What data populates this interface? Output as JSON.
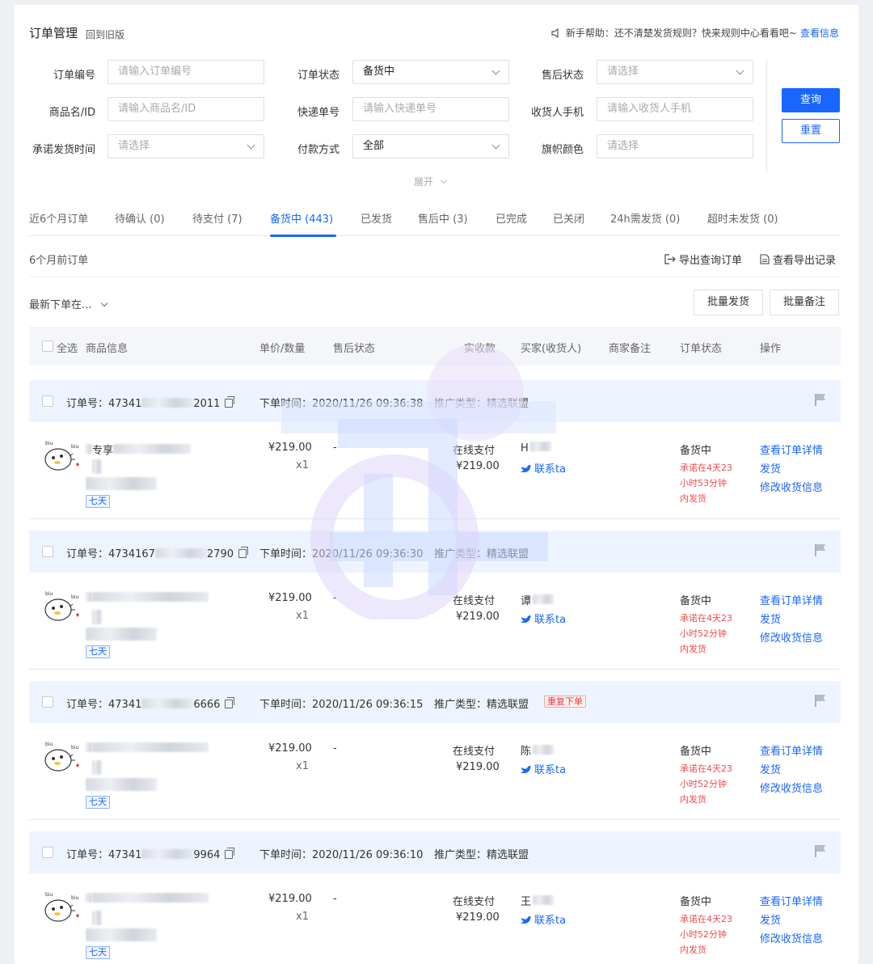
{
  "header": {
    "title": "订单管理",
    "back_old": "回到旧版",
    "help_text": "新手帮助：还不清楚发货规则？快来规则中心看看吧~",
    "help_link": "查看信息"
  },
  "filters": {
    "order_no": {
      "label": "订单编号",
      "placeholder": "请输入订单编号"
    },
    "order_status": {
      "label": "订单状态",
      "value": "备货中"
    },
    "after_sale": {
      "label": "售后状态",
      "placeholder": "请选择"
    },
    "product": {
      "label": "商品名/ID",
      "placeholder": "请输入商品名/ID"
    },
    "express": {
      "label": "快递单号",
      "placeholder": "请输入快递单号"
    },
    "phone": {
      "label": "收货人手机",
      "placeholder": "请输入收货人手机"
    },
    "promise_time": {
      "label": "承诺发货时间",
      "placeholder": "请选择"
    },
    "pay_method": {
      "label": "付款方式",
      "value": "全部"
    },
    "flag_color": {
      "label": "旗帜颜色",
      "placeholder": "请选择"
    },
    "query_label": "查询",
    "reset_label": "重置",
    "expand_label": "展开"
  },
  "tabs": [
    {
      "label": "近6个月订单"
    },
    {
      "label": "待确认 (0)"
    },
    {
      "label": "待支付 (7)"
    },
    {
      "label": "备货中 (443)"
    },
    {
      "label": "已发货"
    },
    {
      "label": "售后中 (3)"
    },
    {
      "label": "已完成"
    },
    {
      "label": "已关闭"
    },
    {
      "label": "24h需发货 (0)"
    },
    {
      "label": "超时未发货 (0)"
    }
  ],
  "toolbar": {
    "older_orders": "6个月前订单",
    "export_query": "导出查询订单",
    "view_export": "查看导出记录",
    "sort": "最新下单在...",
    "batch_ship": "批量发货",
    "batch_note": "批量备注"
  },
  "table_headers": {
    "select_all": "全选",
    "product_info": "商品信息",
    "price_qty": "单价/数量",
    "after_sale": "售后状态",
    "paid": "实收款",
    "buyer": "买家(收货人)",
    "merchant_note": "商家备注",
    "order_status": "订单状态",
    "actions": "操作"
  },
  "orders": [
    {
      "order_prefix": "订单号：47341",
      "order_suffix": "2011",
      "time": "下单时间：2020/11/26 09:36:38",
      "promo": "推广类型：精选联盟",
      "dup_tag": "",
      "product_title": "专享",
      "tag": "七天",
      "price": "¥219.00",
      "qty": "x1",
      "after_sale": "-",
      "pay_method": "在线支付",
      "paid": "¥219.00",
      "buyer": "H",
      "contact": "联系ta",
      "status": "备货中",
      "promise": [
        "承诺在4天23",
        "小时53分钟",
        "内发货"
      ],
      "actions": [
        "查看订单详情",
        "发货",
        "修改收货信息"
      ]
    },
    {
      "order_prefix": "订单号：4734167",
      "order_suffix": "2790",
      "time": "下单时间：2020/11/26 09:36:30",
      "promo": "推广类型：精选联盟",
      "dup_tag": "",
      "product_title": "",
      "tag": "七天",
      "price": "¥219.00",
      "qty": "x1",
      "after_sale": "-",
      "pay_method": "在线支付",
      "paid": "¥219.00",
      "buyer": "谭",
      "contact": "联系ta",
      "status": "备货中",
      "promise": [
        "承诺在4天23",
        "小时52分钟",
        "内发货"
      ],
      "actions": [
        "查看订单详情",
        "发货",
        "修改收货信息"
      ]
    },
    {
      "order_prefix": "订单号：47341",
      "order_suffix": "6666",
      "time": "下单时间：2020/11/26 09:36:15",
      "promo": "推广类型：精选联盟",
      "dup_tag": "重复下单",
      "product_title": "",
      "tag": "七天",
      "price": "¥219.00",
      "qty": "x1",
      "after_sale": "-",
      "pay_method": "在线支付",
      "paid": "¥219.00",
      "buyer": "陈",
      "contact": "联系ta",
      "status": "备货中",
      "promise": [
        "承诺在4天23",
        "小时52分钟",
        "内发货"
      ],
      "actions": [
        "查看订单详情",
        "发货",
        "修改收货信息"
      ]
    },
    {
      "order_prefix": "订单号：47341",
      "order_suffix": "9964",
      "time": "下单时间：2020/11/26 09:36:10",
      "promo": "推广类型：精选联盟",
      "dup_tag": "",
      "product_title": "",
      "tag": "七天",
      "price": "¥219.00",
      "qty": "x1",
      "after_sale": "-",
      "pay_method": "在线支付",
      "paid": "¥219.00",
      "buyer": "王",
      "contact": "联系ta",
      "status": "备货中",
      "promise": [
        "承诺在4天23",
        "小时52分钟",
        "内发货"
      ],
      "actions": [
        "查看订单详情",
        "发货",
        "修改收货信息"
      ]
    }
  ],
  "colors": {
    "accent": "#1966ff",
    "warn": "#f24c4c",
    "row_head": "#eef4ff"
  }
}
